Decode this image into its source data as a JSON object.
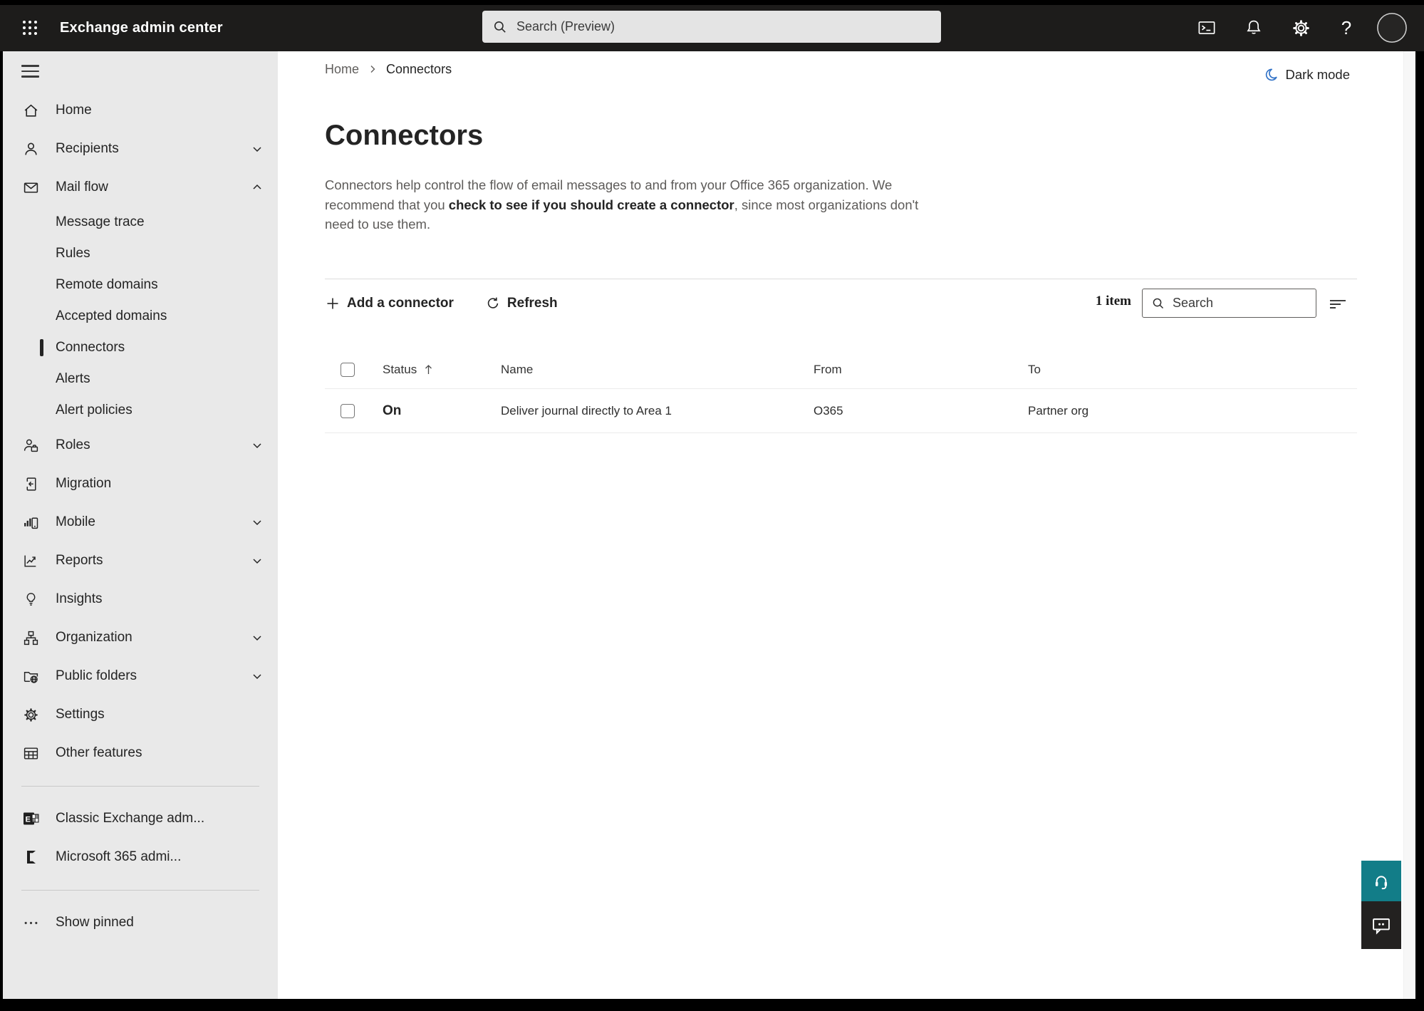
{
  "header": {
    "app_title": "Exchange admin center",
    "search_placeholder": "Search (Preview)"
  },
  "sidebar": {
    "items": [
      {
        "label": "Home"
      },
      {
        "label": "Recipients"
      },
      {
        "label": "Mail flow"
      },
      {
        "label": "Message trace"
      },
      {
        "label": "Rules"
      },
      {
        "label": "Remote domains"
      },
      {
        "label": "Accepted domains"
      },
      {
        "label": "Connectors"
      },
      {
        "label": "Alerts"
      },
      {
        "label": "Alert policies"
      },
      {
        "label": "Roles"
      },
      {
        "label": "Migration"
      },
      {
        "label": "Mobile"
      },
      {
        "label": "Reports"
      },
      {
        "label": "Insights"
      },
      {
        "label": "Organization"
      },
      {
        "label": "Public folders"
      },
      {
        "label": "Settings"
      },
      {
        "label": "Other features"
      },
      {
        "label": "Classic Exchange adm..."
      },
      {
        "label": "Microsoft 365 admi..."
      },
      {
        "label": "Show pinned"
      }
    ]
  },
  "breadcrumb": {
    "home": "Home",
    "current": "Connectors"
  },
  "dark_mode_label": "Dark mode",
  "page": {
    "title": "Connectors",
    "description_prefix": "Connectors help control the flow of email messages to and from your Office 365 organization. We recommend that you ",
    "description_emphasis": "check to see if you should create a connector",
    "description_suffix": ", since most organizations don't need to use them."
  },
  "toolbar": {
    "add_label": "Add a connector",
    "refresh_label": "Refresh",
    "items_count": "1 item",
    "search_placeholder": "Search"
  },
  "table": {
    "columns": [
      "Status",
      "Name",
      "From",
      "To"
    ],
    "rows": [
      {
        "status": "On",
        "name": "Deliver journal directly to Area 1",
        "from": "O365",
        "to": "Partner org"
      }
    ]
  },
  "colors": {
    "accent_teal": "#127d88",
    "moon_blue": "#3273c7"
  }
}
